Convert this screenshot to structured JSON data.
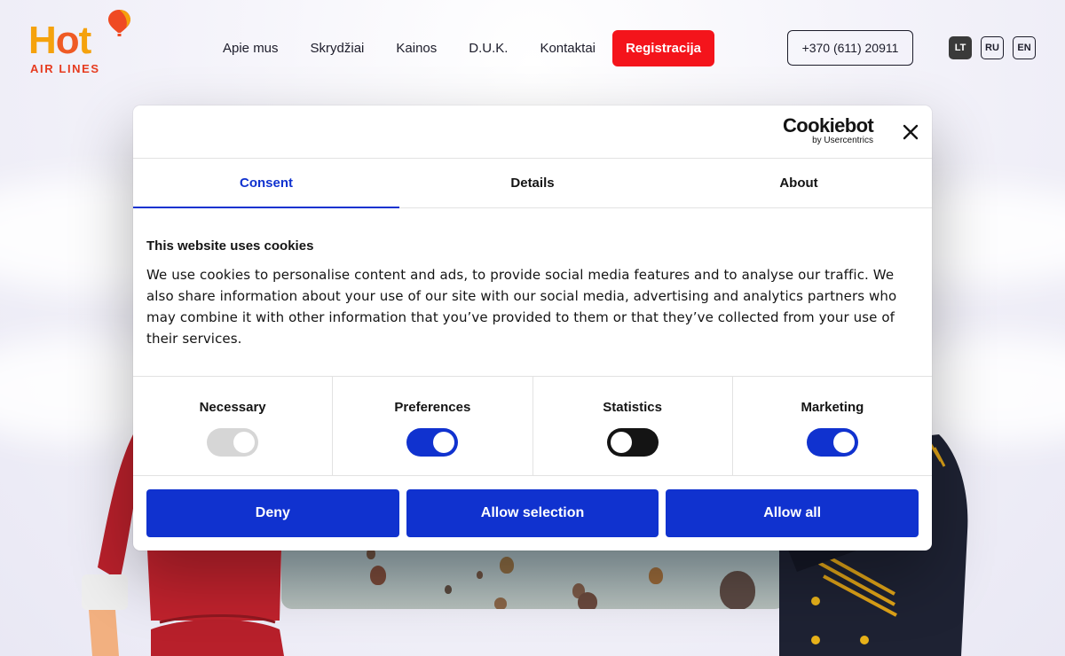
{
  "site": {
    "logo": {
      "word": "Hot",
      "word_o_split": [
        "H",
        "o",
        "t"
      ],
      "sub": "AIR LINES"
    },
    "nav": [
      "Apie mus",
      "Skrydžiai",
      "Kainos",
      "D.U.K.",
      "Kontaktai"
    ],
    "register_label": "Registracija",
    "phone": "+370 (611) 20911",
    "languages": [
      {
        "code": "LT",
        "active": true
      },
      {
        "code": "RU",
        "active": false
      },
      {
        "code": "EN",
        "active": false
      }
    ]
  },
  "dialog": {
    "brand": {
      "name": "Cookiebot",
      "by": "by Usercentrics"
    },
    "tabs": [
      {
        "label": "Consent",
        "active": true
      },
      {
        "label": "Details",
        "active": false
      },
      {
        "label": "About",
        "active": false
      }
    ],
    "title": "This website uses cookies",
    "text": "We use cookies to personalise content and ads, to provide social media features and to analyse our traffic. We also share information about your use of our site with our social media, advertising and analytics partners who may combine it with other information that you’ve provided to them or that they’ve collected from your use of their services.",
    "toggles": [
      {
        "label": "Necessary",
        "state": "disabled-on"
      },
      {
        "label": "Preferences",
        "state": "on"
      },
      {
        "label": "Statistics",
        "state": "off"
      },
      {
        "label": "Marketing",
        "state": "on"
      }
    ],
    "buttons": {
      "deny": "Deny",
      "allow_selection": "Allow selection",
      "allow_all": "Allow all"
    }
  },
  "colors": {
    "accent_blue": "#1032cf",
    "register_red": "#f4141b",
    "logo_orange": "#f5a20d",
    "logo_red": "#e63b1f"
  }
}
